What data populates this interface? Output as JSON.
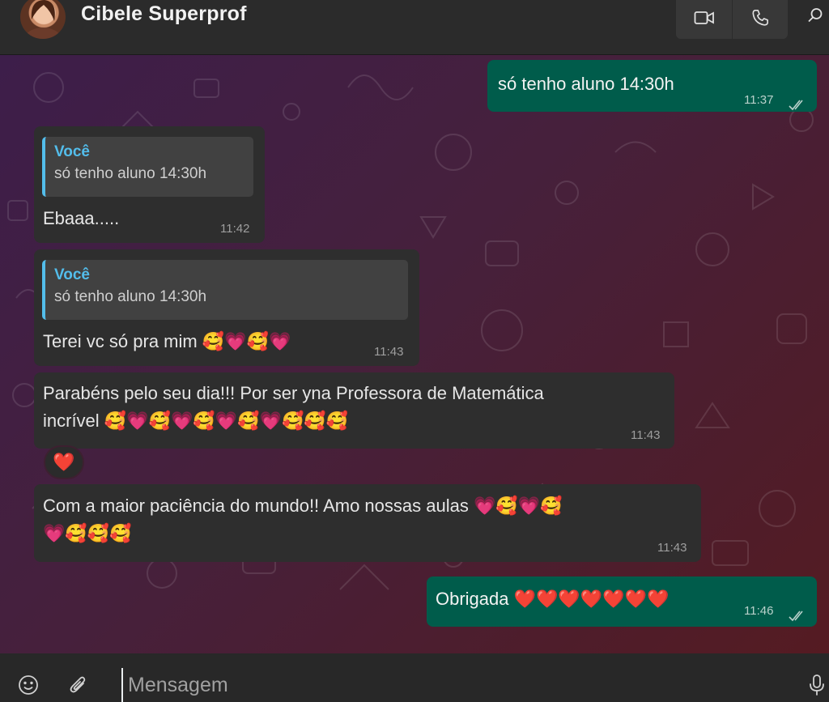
{
  "header": {
    "contact_name": "Cibele Superprof",
    "video_call_icon": "video-camera-icon",
    "voice_call_icon": "phone-icon",
    "search_icon": "search-icon"
  },
  "messages": [
    {
      "direction": "outgoing",
      "text": "só tenho aluno 14:30h",
      "time": "11:37",
      "status": "read"
    },
    {
      "direction": "incoming",
      "quote": {
        "author": "Você",
        "text": "só tenho aluno 14:30h"
      },
      "text": "Ebaaa.....",
      "time": "11:42"
    },
    {
      "direction": "incoming",
      "quote": {
        "author": "Você",
        "text": "só tenho aluno 14:30h"
      },
      "text": "Terei vc só pra mim 🥰💗🥰💗",
      "time": "11:43"
    },
    {
      "direction": "incoming",
      "lines": [
        "Parabéns pelo seu dia!!! Por ser yna Professora de Matemática",
        "incrível 🥰💗🥰💗🥰💗🥰💗🥰🥰🥰"
      ],
      "time": "11:43",
      "reaction": "❤️"
    },
    {
      "direction": "incoming",
      "lines": [
        "Com a maior paciência do mundo!! Amo nossas aulas 💗🥰💗🥰",
        "💗🥰🥰🥰"
      ],
      "time": "11:43"
    },
    {
      "direction": "outgoing",
      "text": "Obrigada ❤️❤️❤️❤️❤️❤️❤️",
      "time": "11:46",
      "status": "read"
    }
  ],
  "composer": {
    "placeholder": "Mensagem",
    "emoji_icon": "emoji-icon",
    "attach_icon": "paperclip-icon",
    "mic_icon": "microphone-icon"
  },
  "colors": {
    "incoming_bubble": "#2e2e2e",
    "outgoing_bubble": "#005c4b",
    "quote_accent": "#53bdeb",
    "header_bg": "#2b2b2b"
  }
}
